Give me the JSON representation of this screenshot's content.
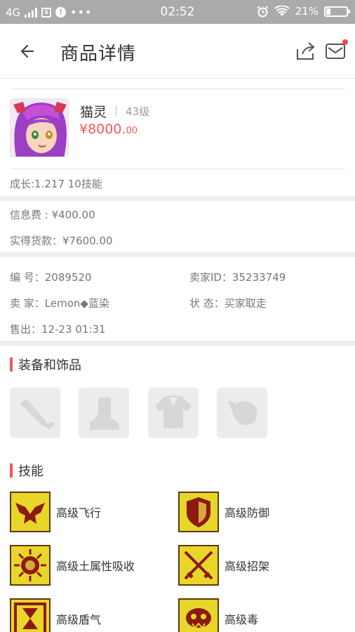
{
  "status_bar": {
    "network": "4G",
    "time": "02:52",
    "battery": "21%",
    "battery_level": 0.21,
    "icons": [
      "signal-icon",
      "sim-icon",
      "alert-icon",
      "more-icon",
      "alarm-icon",
      "wifi-icon",
      "battery-icon"
    ]
  },
  "header": {
    "title": "商品详情",
    "icons": [
      "back-arrow-icon",
      "share-icon",
      "mail-icon"
    ]
  },
  "product": {
    "name": "猫灵",
    "separator": "|",
    "level": "43级",
    "price_main": "¥8000.",
    "price_cents": "00",
    "growth": "成长:1.217 10技能"
  },
  "fees": {
    "info_fee": "信息费 : ¥400.00",
    "actual": "实得货款：¥7600.00"
  },
  "meta": {
    "serial": "编  号：2089520",
    "seller_id": "卖家ID：35233749",
    "seller": "卖  家：Lemon◆蓝染",
    "status": "状  态：买家取走",
    "sold": "售出：12-23 01:31"
  },
  "equipment": {
    "title": "装备和饰品",
    "slots": [
      "weapon-slot-icon",
      "boots-slot-icon",
      "armor-slot-icon",
      "accessory-slot-icon"
    ]
  },
  "skills": {
    "title": "技能",
    "items": [
      {
        "label": "高级飞行",
        "icon": "eagle-icon"
      },
      {
        "label": "高级防御",
        "icon": "shield-icon"
      },
      {
        "label": "高级土属性吸收",
        "icon": "earth-icon"
      },
      {
        "label": "高级招架",
        "icon": "crossed-swords-icon"
      },
      {
        "label": "高级盾气",
        "icon": "hourglass-icon"
      },
      {
        "label": "高级毒",
        "icon": "poison-icon"
      }
    ]
  },
  "colors": {
    "accent": "#ee5a5a",
    "status_bar": "#aaaaaa",
    "skill_icon_bg": "#e9d62b",
    "skill_icon_art": "#8b1a10"
  }
}
